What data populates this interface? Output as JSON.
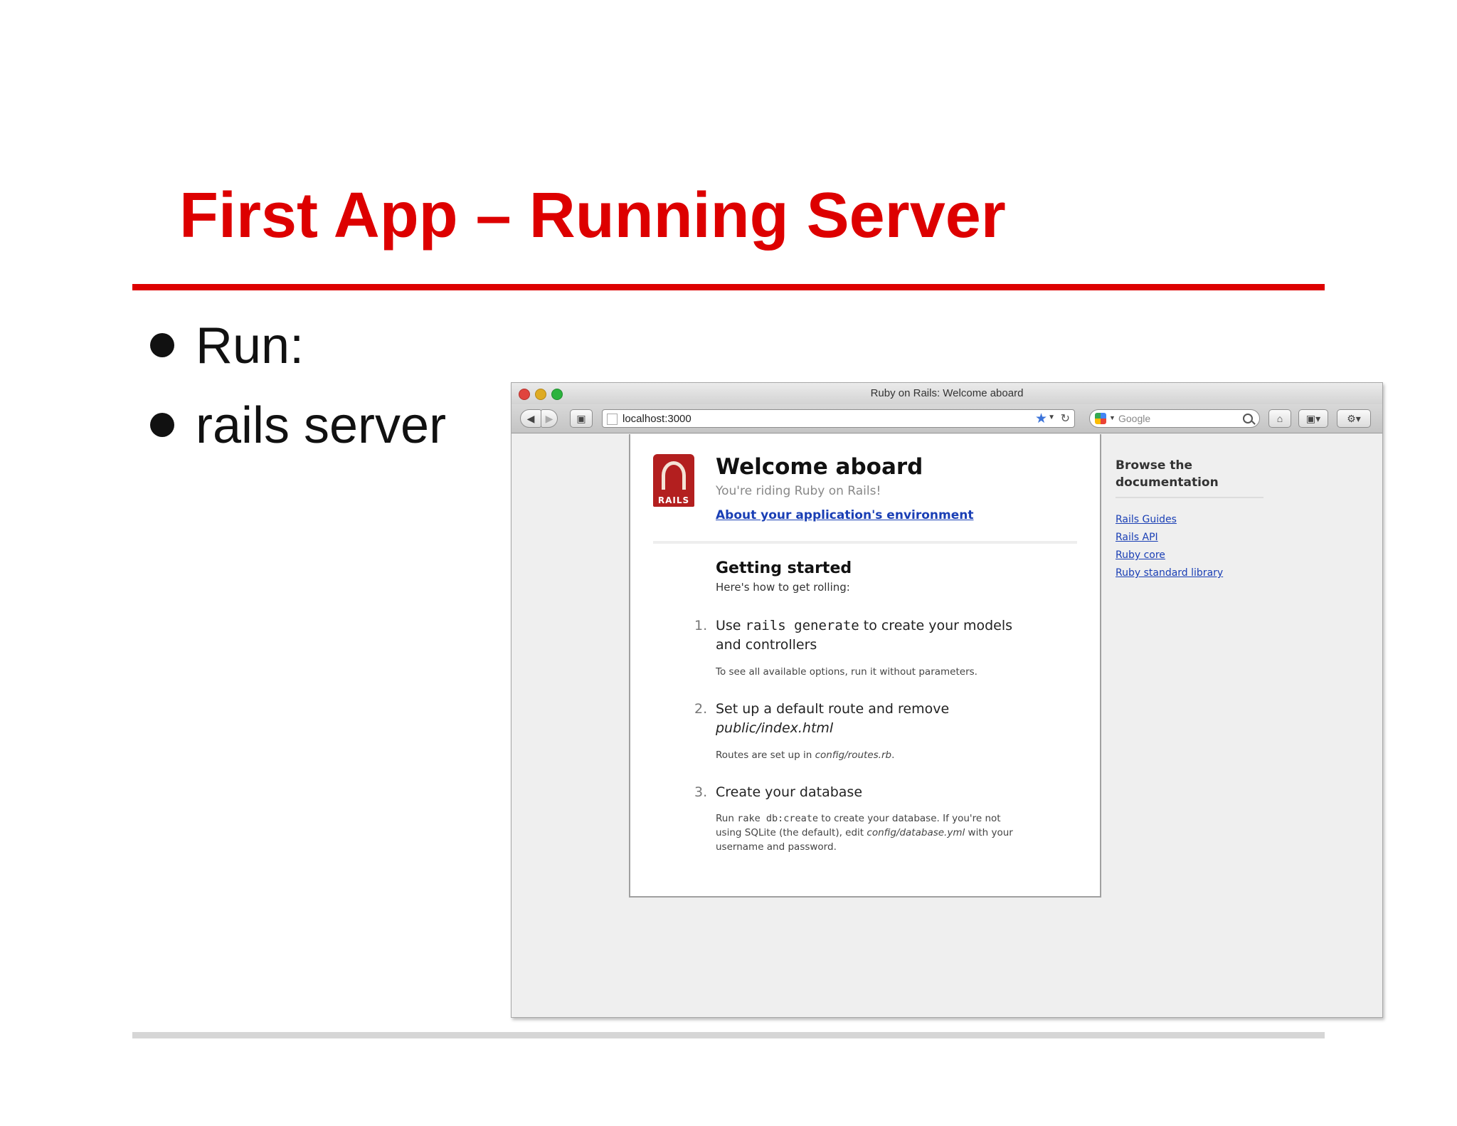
{
  "slide": {
    "title": "First App – Running Server",
    "bullets": [
      "Run:",
      "rails server"
    ]
  },
  "browser": {
    "window_title": "Ruby on Rails: Welcome aboard",
    "url": "localhost:3000",
    "search_placeholder": "Google",
    "page": {
      "heading": "Welcome aboard",
      "subheading": "You're riding Ruby on Rails!",
      "env_link": "About your application's environment",
      "getting_started": {
        "title": "Getting started",
        "subtitle": "Here's how to get rolling:",
        "steps": [
          {
            "num": "1.",
            "pre": "Use ",
            "code": "rails generate",
            "post": " to create your models",
            "line2": "and controllers",
            "note": "To see all available options, run it without parameters."
          },
          {
            "num": "2.",
            "line1": "Set up a default route and remove",
            "line2": "public/index.html",
            "note_pre": "Routes are set up in ",
            "note_em": "config/routes.rb",
            "note_post": "."
          },
          {
            "num": "3.",
            "line1": "Create your database",
            "note_pre": "Run ",
            "note_code": "rake db:create",
            "note_mid": " to create your database. If you're not",
            "note_line2_pre": "using SQLite (the default), edit ",
            "note_line2_em": "config/database.yml",
            "note_line2_post": " with your",
            "note_line3": "username and password."
          }
        ]
      }
    },
    "sidebar": {
      "heading_line1": "Browse the",
      "heading_line2": "documentation",
      "links": [
        "Rails Guides",
        "Rails API",
        "Ruby core",
        "Ruby standard library"
      ]
    }
  },
  "colors": {
    "accent_red": "#dd0000",
    "link_blue": "#1a3fb5"
  }
}
